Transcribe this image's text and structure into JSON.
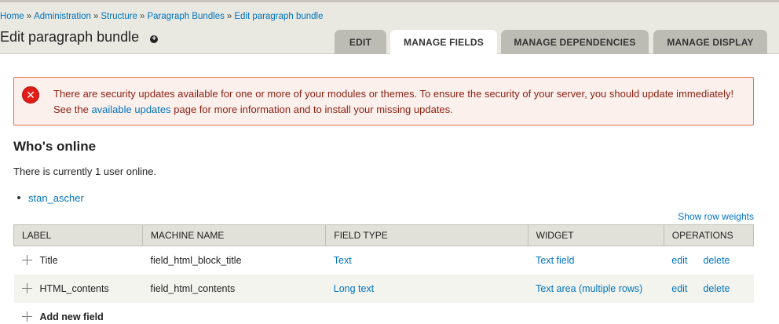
{
  "breadcrumb": [
    "Home",
    "Administration",
    "Structure",
    "Paragraph Bundles",
    "Edit paragraph bundle"
  ],
  "page_title": "Edit paragraph bundle",
  "tabs": [
    "EDIT",
    "MANAGE FIELDS",
    "MANAGE DEPENDENCIES",
    "MANAGE DISPLAY"
  ],
  "active_tab": "MANAGE FIELDS",
  "message": {
    "before": "There are security updates available for one or more of your modules or themes. To ensure the security of your server, you should update immediately! See the ",
    "link": "available updates",
    "after": " page for more information and to install your missing updates."
  },
  "whos_online": {
    "title": "Who's online",
    "text": "There is currently 1 user online.",
    "users": [
      "stan_ascher"
    ]
  },
  "show_row_weights": "Show row weights",
  "table": {
    "headers": [
      "LABEL",
      "MACHINE NAME",
      "FIELD TYPE",
      "WIDGET",
      "OPERATIONS"
    ],
    "rows": [
      {
        "label": "Title",
        "machine": "field_html_block_title",
        "type": "Text",
        "widget": "Text field",
        "edit": "edit",
        "delete": "delete"
      },
      {
        "label": "HTML_contents",
        "machine": "field_html_contents",
        "type": "Long text",
        "widget": "Text area (multiple rows)",
        "edit": "edit",
        "delete": "delete"
      }
    ],
    "add_new": "Add new field"
  },
  "colors": {
    "link": "#0074bd",
    "error_border": "#e4704a",
    "error_bg": "#fcf0ec"
  }
}
